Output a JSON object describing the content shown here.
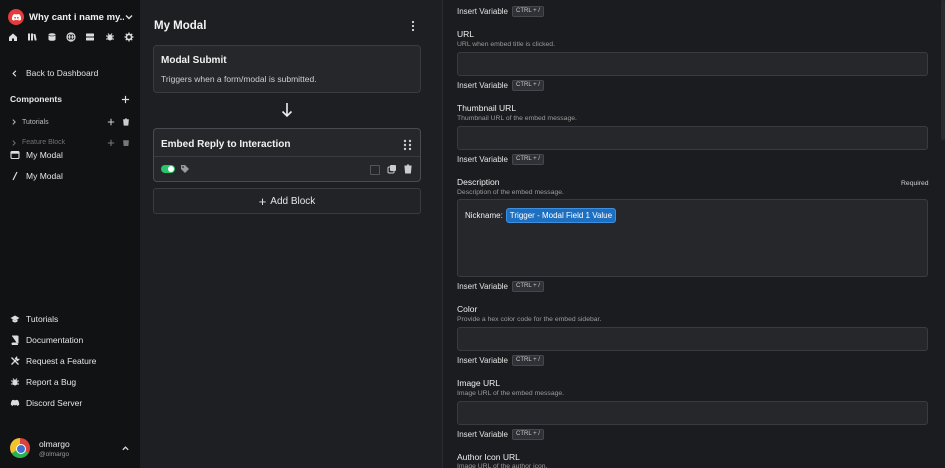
{
  "sidebar": {
    "server_name": "Why cant i name my...",
    "back_label": "Back to Dashboard",
    "components_title": "Components",
    "tree": [
      {
        "label": "Tutorials"
      },
      {
        "label": "Feature Block"
      }
    ],
    "items": [
      {
        "label": "My Modal"
      },
      {
        "label": "My Modal"
      }
    ],
    "menu": [
      {
        "label": "Tutorials",
        "icon": "graduation-cap-icon"
      },
      {
        "label": "Documentation",
        "icon": "book-icon"
      },
      {
        "label": "Request a Feature",
        "icon": "tools-icon"
      },
      {
        "label": "Report a Bug",
        "icon": "bug-icon"
      },
      {
        "label": "Discord Server",
        "icon": "discord-icon"
      }
    ],
    "user": {
      "name": "olmargo",
      "handle": "@olmargo"
    }
  },
  "flow": {
    "title": "My Modal",
    "trigger_block": {
      "title": "Modal Submit",
      "subtitle": "Triggers when a form/modal is submitted."
    },
    "action_block": {
      "title": "Embed Reply to Interaction"
    },
    "add_block_label": "Add Block"
  },
  "panel": {
    "insert_label": "Insert Variable",
    "shortcut": "CTRL + /",
    "fields": {
      "url": {
        "label": "URL",
        "desc": "URL when embed title is clicked."
      },
      "thumbnail": {
        "label": "Thumbnail URL",
        "desc": "Thumbnail URL of the embed message."
      },
      "description": {
        "label": "Description",
        "desc": "Description of the embed message.",
        "required": "Required",
        "prefix": "Nickname:",
        "variable": "Trigger - Modal Field 1 Value"
      },
      "color": {
        "label": "Color",
        "desc": "Provide a hex color code for the embed sidebar."
      },
      "image": {
        "label": "Image URL",
        "desc": "Image URL of the embed message."
      },
      "author_icon": {
        "label": "Author Icon URL",
        "desc": "Image URL of the author icon."
      }
    }
  },
  "colors": {
    "accent": "#1e6fc0",
    "toggle_on": "#29c46a",
    "server_logo": "#e53b3b"
  }
}
